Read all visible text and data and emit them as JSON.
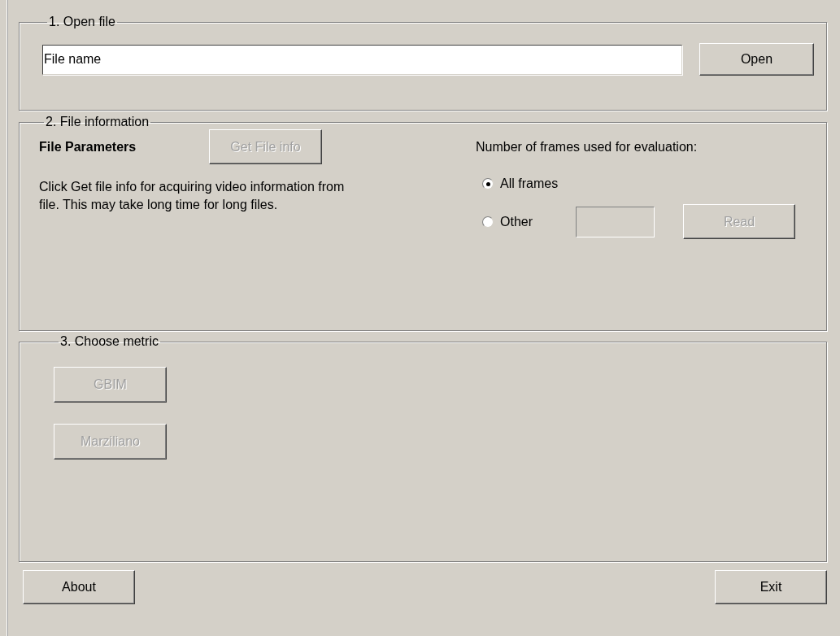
{
  "open_file": {
    "title": "1. Open file",
    "file_field": {
      "value": "File name"
    },
    "open_button": {
      "label": "Open",
      "disabled": false
    }
  },
  "file_information": {
    "title": "2. File information",
    "heading": "File Parameters",
    "get_info_button": {
      "label": "Get File info",
      "disabled": true
    },
    "description": "Click Get file info for acquiring video information from file. This may take long time for long files.",
    "frames_label": "Number of frames used for evaluation:",
    "frame_options": [
      {
        "label": "All frames",
        "selected": true
      },
      {
        "label": "Other",
        "selected": false
      }
    ],
    "other_field": {
      "disabled": true
    },
    "read_button": {
      "label": "Read",
      "disabled": true
    }
  },
  "choose_metric": {
    "title": "3. Choose metric",
    "buttons": [
      {
        "label": "GBIM",
        "disabled": true
      },
      {
        "label": "Marziliano",
        "disabled": true
      }
    ]
  },
  "footer_buttons": [
    {
      "label": "About",
      "disabled": false
    },
    {
      "label": "Exit",
      "disabled": false
    }
  ]
}
